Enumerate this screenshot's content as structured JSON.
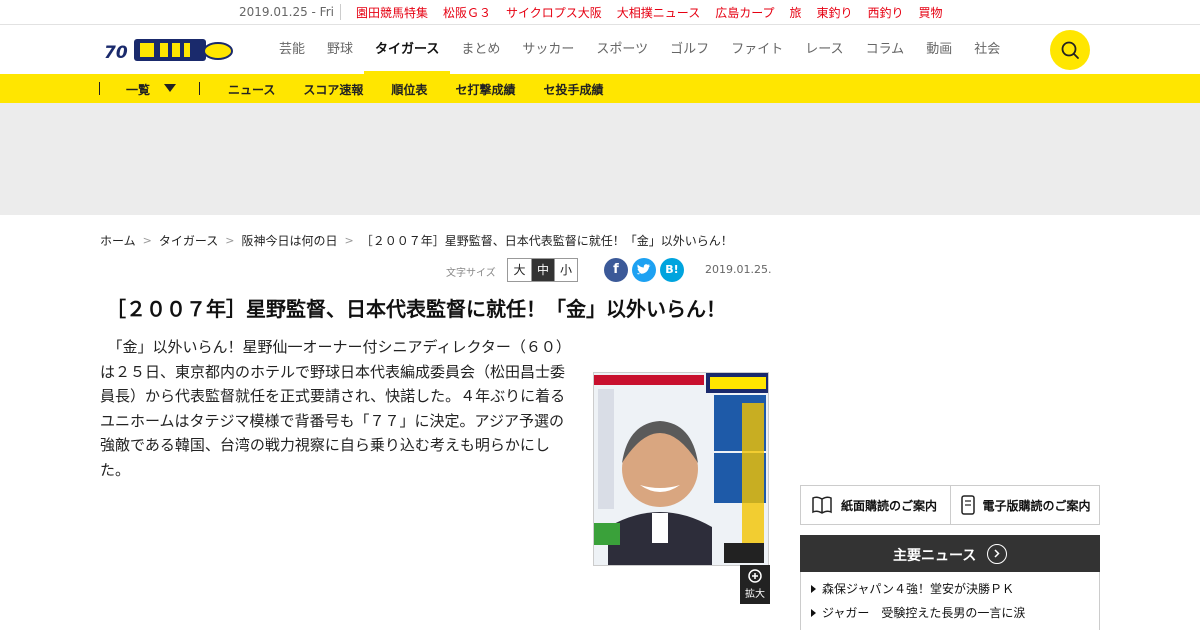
{
  "topbar": {
    "date": "2019.01.25 - Fri",
    "links": [
      "園田競馬特集",
      "松阪Ｇ３",
      "サイクロプス大阪",
      "大相撲ニュース",
      "広島カープ",
      "旅",
      "東釣り",
      "西釣り",
      "買物"
    ]
  },
  "header": {
    "nav": [
      "芸能",
      "野球",
      "タイガース",
      "まとめ",
      "サッカー",
      "スポーツ",
      "ゴルフ",
      "ファイト",
      "レース",
      "コラム",
      "動画",
      "社会"
    ],
    "active_index": 2
  },
  "subnav": {
    "ichiran": "一覧",
    "links": [
      "ニュース",
      "スコア速報",
      "順位表",
      "セ打撃成績",
      "セ投手成績"
    ]
  },
  "breadcrumb": [
    "ホーム",
    "タイガース",
    "阪神今日は何の日",
    "［２００７年］星野監督、日本代表監督に就任！「金」以外いらん！"
  ],
  "meta": {
    "font_size_label": "文字サイズ",
    "font_sizes": [
      "大",
      "中",
      "小"
    ],
    "date": "2019.01.25."
  },
  "article": {
    "title": "［２００７年］星野監督、日本代表監督に就任！「金」以外いらん！",
    "body": "　「金」以外いらん！星野仙一オーナー付シニアディレクター（６０）は２５日、東京都内のホテルで野球日本代表編成委員会（松田昌士委員長）から代表監督就任を正式要請され、快諾した。４年ぶりに着るユニホームはタテジマ模様で背番号も「７７」に決定。アジア予選の強敵である韓国、台湾の戦力視察に自ら乗り込む考えも明らかにした。",
    "zoom_label": "拡大"
  },
  "sidebar": {
    "subscribe_print": "紙面購読のご案内",
    "subscribe_digital": "電子版購読のご案内",
    "news_heading": "主要ニュース",
    "news": [
      "森保ジャパン４強！堂安が決勝ＰＫ",
      "ジャガー　受験控えた長男の一言に涙"
    ]
  },
  "colors": {
    "brand_yellow": "#ffe600",
    "topbar_red": "#e60012",
    "dark": "#333333"
  }
}
